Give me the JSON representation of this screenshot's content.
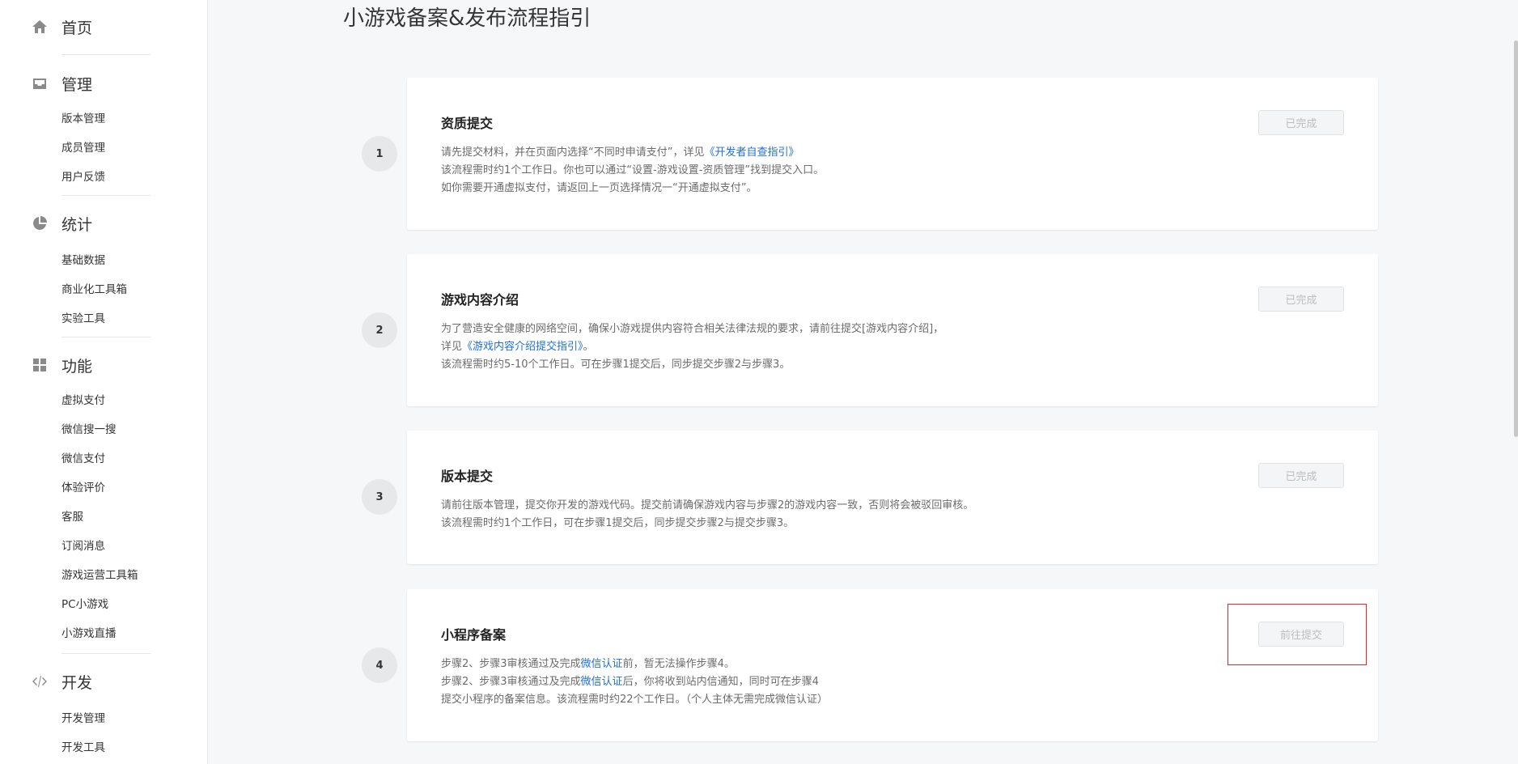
{
  "sidebar": {
    "home": {
      "label": "首页",
      "icon": "home-icon"
    },
    "manage": {
      "label": "管理",
      "icon": "inbox-icon",
      "items": [
        "版本管理",
        "成员管理",
        "用户反馈"
      ]
    },
    "stats": {
      "label": "统计",
      "icon": "pie-chart-icon",
      "items": [
        "基础数据",
        "商业化工具箱",
        "实验工具"
      ]
    },
    "features": {
      "label": "功能",
      "icon": "grid-icon",
      "items": [
        "虚拟支付",
        "微信搜一搜",
        "微信支付",
        "体验评价",
        "客服",
        "订阅消息",
        "游戏运营工具箱",
        "PC小游戏",
        "小游戏直播"
      ]
    },
    "dev": {
      "label": "开发",
      "icon": "code-icon",
      "items": [
        "开发管理",
        "开发工具"
      ]
    }
  },
  "main": {
    "title": "小游戏备案&发布流程指引",
    "steps": [
      {
        "num": "1",
        "title": "资质提交",
        "button": "已完成",
        "desc": {
          "l1a": "请先提交材料，并在页面内选择“不同时申请支付”，详见",
          "l1link": "《开发者自查指引》",
          "l2": "该流程需时约1个工作日。你也可以通过“设置-游戏设置-资质管理”找到提交入口。",
          "l3": "如你需要开通虚拟支付，请返回上一页选择情况一“开通虚拟支付”。"
        }
      },
      {
        "num": "2",
        "title": "游戏内容介绍",
        "button": "已完成",
        "desc": {
          "l1": "为了营造安全健康的网络空间，确保小游戏提供内容符合相关法律法规的要求，请前往提交[游戏内容介绍]，",
          "l2a": "详见",
          "l2link": "《游戏内容介绍提交指引》",
          "l2b": "。",
          "l3": "该流程需时约5-10个工作日。可在步骤1提交后，同步提交步骤2与步骤3。"
        }
      },
      {
        "num": "3",
        "title": "版本提交",
        "button": "已完成",
        "desc": {
          "l1": "请前往版本管理，提交你开发的游戏代码。提交前请确保游戏内容与步骤2的游戏内容一致，否则将会被驳回审核。",
          "l2": "该流程需时约1个工作日，可在步骤1提交后，同步提交步骤2与提交步骤3。"
        }
      },
      {
        "num": "4",
        "title": "小程序备案",
        "button": "前往提交",
        "desc": {
          "l1a": "步骤2、步骤3审核通过及完成",
          "l1link": "微信认证",
          "l1b": "前，暂无法操作步骤4。",
          "l2a": "步骤2、步骤3审核通过及完成",
          "l2link": "微信认证",
          "l2b": "后，你将收到站内信通知，同时可在步骤4",
          "l3": "提交小程序的备案信息。该流程需时约22个工作日。（个人主体无需完成微信认证）"
        }
      }
    ]
  }
}
